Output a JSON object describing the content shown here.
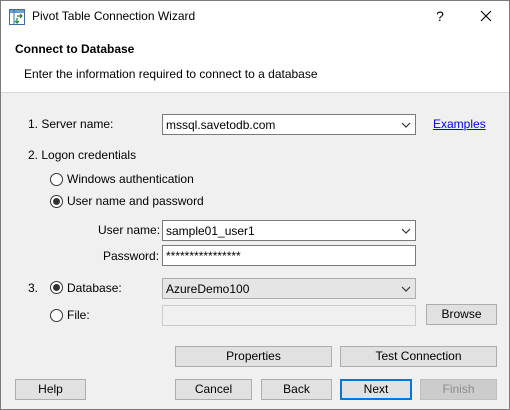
{
  "window": {
    "title": "Pivot Table Connection Wizard",
    "help_glyph": "?"
  },
  "header": {
    "title": "Connect to Database",
    "subtitle": "Enter the information required to connect to a database"
  },
  "server": {
    "label": "1. Server name:",
    "value": "mssql.savetodb.com",
    "examples_link": "Examples"
  },
  "logon": {
    "label": "2. Logon credentials",
    "windows_auth": "Windows authentication",
    "user_pass": "User name and password",
    "selected": "user_pass",
    "user_label": "User name:",
    "user_value": "sample01_user1",
    "password_label": "Password:",
    "password_value": "****************"
  },
  "database": {
    "number": "3.",
    "db_label": "Database:",
    "db_value": "AzureDemo100",
    "file_label": "File:",
    "file_value": "",
    "browse": "Browse",
    "selected": "database"
  },
  "buttons": {
    "properties": "Properties",
    "test_connection": "Test Connection",
    "help": "Help",
    "cancel": "Cancel",
    "back": "Back",
    "next": "Next",
    "finish": "Finish"
  },
  "colors": {
    "link": "#0000ee",
    "focus_border": "#0078d7",
    "background": "#f0f0f0"
  }
}
